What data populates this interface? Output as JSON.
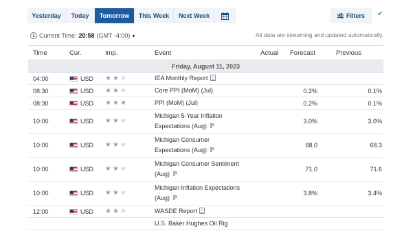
{
  "tabs": [
    {
      "label": "Yesterday"
    },
    {
      "label": "Today"
    },
    {
      "label": "Tomorrow",
      "active": true
    },
    {
      "label": "This Week"
    },
    {
      "label": "Next Week"
    }
  ],
  "filters_label": "Filters",
  "time_bar": {
    "prefix": "Current Time:",
    "time": "20:58",
    "timezone": "(GMT -4:00)"
  },
  "stream_note": "All data are streaming and updated automatically.",
  "table": {
    "headers": {
      "time": "Time",
      "currency": "Cur.",
      "importance": "Imp.",
      "event": "Event",
      "actual": "Actual",
      "forecast": "Forecast",
      "previous": "Previous"
    },
    "date": "Friday, August 11, 2023",
    "rows": [
      {
        "time": "04:00",
        "currency": "USD",
        "importance": 2,
        "event_line1": "IEA Monthly Report",
        "event_line2": "",
        "actual": "",
        "forecast": "",
        "previous": ""
      },
      {
        "time": "08:30",
        "currency": "USD",
        "importance": 2,
        "event_line1": "Core PPI (MoM) (Jul)",
        "event_line2": "",
        "actual": "",
        "forecast": "0.2%",
        "previous": "0.1%"
      },
      {
        "time": "08:30",
        "currency": "USD",
        "importance": 3,
        "event_line1": "PPI (MoM) (Jul)",
        "event_line2": "",
        "actual": "",
        "forecast": "0.2%",
        "previous": "0.1%"
      },
      {
        "time": "10:00",
        "currency": "USD",
        "importance": 2,
        "event_line1": "Michigan 5-Year Inflation",
        "event_line2": "Expectations (Aug)",
        "actual": "",
        "forecast": "3.0%",
        "previous": "3.0%"
      },
      {
        "time": "10:00",
        "currency": "USD",
        "importance": 2,
        "event_line1": "Michigan Consumer",
        "event_line2": "Expectations (Aug)",
        "actual": "",
        "forecast": "68.0",
        "previous": "68.3"
      },
      {
        "time": "10:00",
        "currency": "USD",
        "importance": 2,
        "event_line1": "Michigan Consumer Sentiment",
        "event_line2": "(Aug)",
        "actual": "",
        "forecast": "71.0",
        "previous": "71.6"
      },
      {
        "time": "10:00",
        "currency": "USD",
        "importance": 2,
        "event_line1": "Michigan Inflation Expectations",
        "event_line2": "(Aug)",
        "actual": "",
        "forecast": "3.8%",
        "previous": "3.4%"
      },
      {
        "time": "12:00",
        "currency": "USD",
        "importance": 2,
        "event_line1": "WASDE Report",
        "event_line2": "",
        "actual": "",
        "forecast": "",
        "previous": ""
      },
      {
        "time": "",
        "currency": "",
        "importance": 0,
        "event_line1": "U.S. Baker Hughes Oil Rig",
        "event_line2": "",
        "actual": "",
        "forecast": "",
        "previous": ""
      }
    ]
  },
  "icons": {
    "calendar": "calendar-icon",
    "filter": "filter-sliders-icon",
    "check": "check-icon",
    "clock": "clock-icon",
    "flag": "us-flag-icon",
    "document": "document-icon",
    "preliminary": "preliminary-p-icon",
    "star": "star-icon"
  },
  "colors": {
    "active_tab": "#1e5aa0",
    "tab_text": "#1a4f86",
    "check": "#41a33a",
    "date_row_bg": "#e9ebef"
  }
}
